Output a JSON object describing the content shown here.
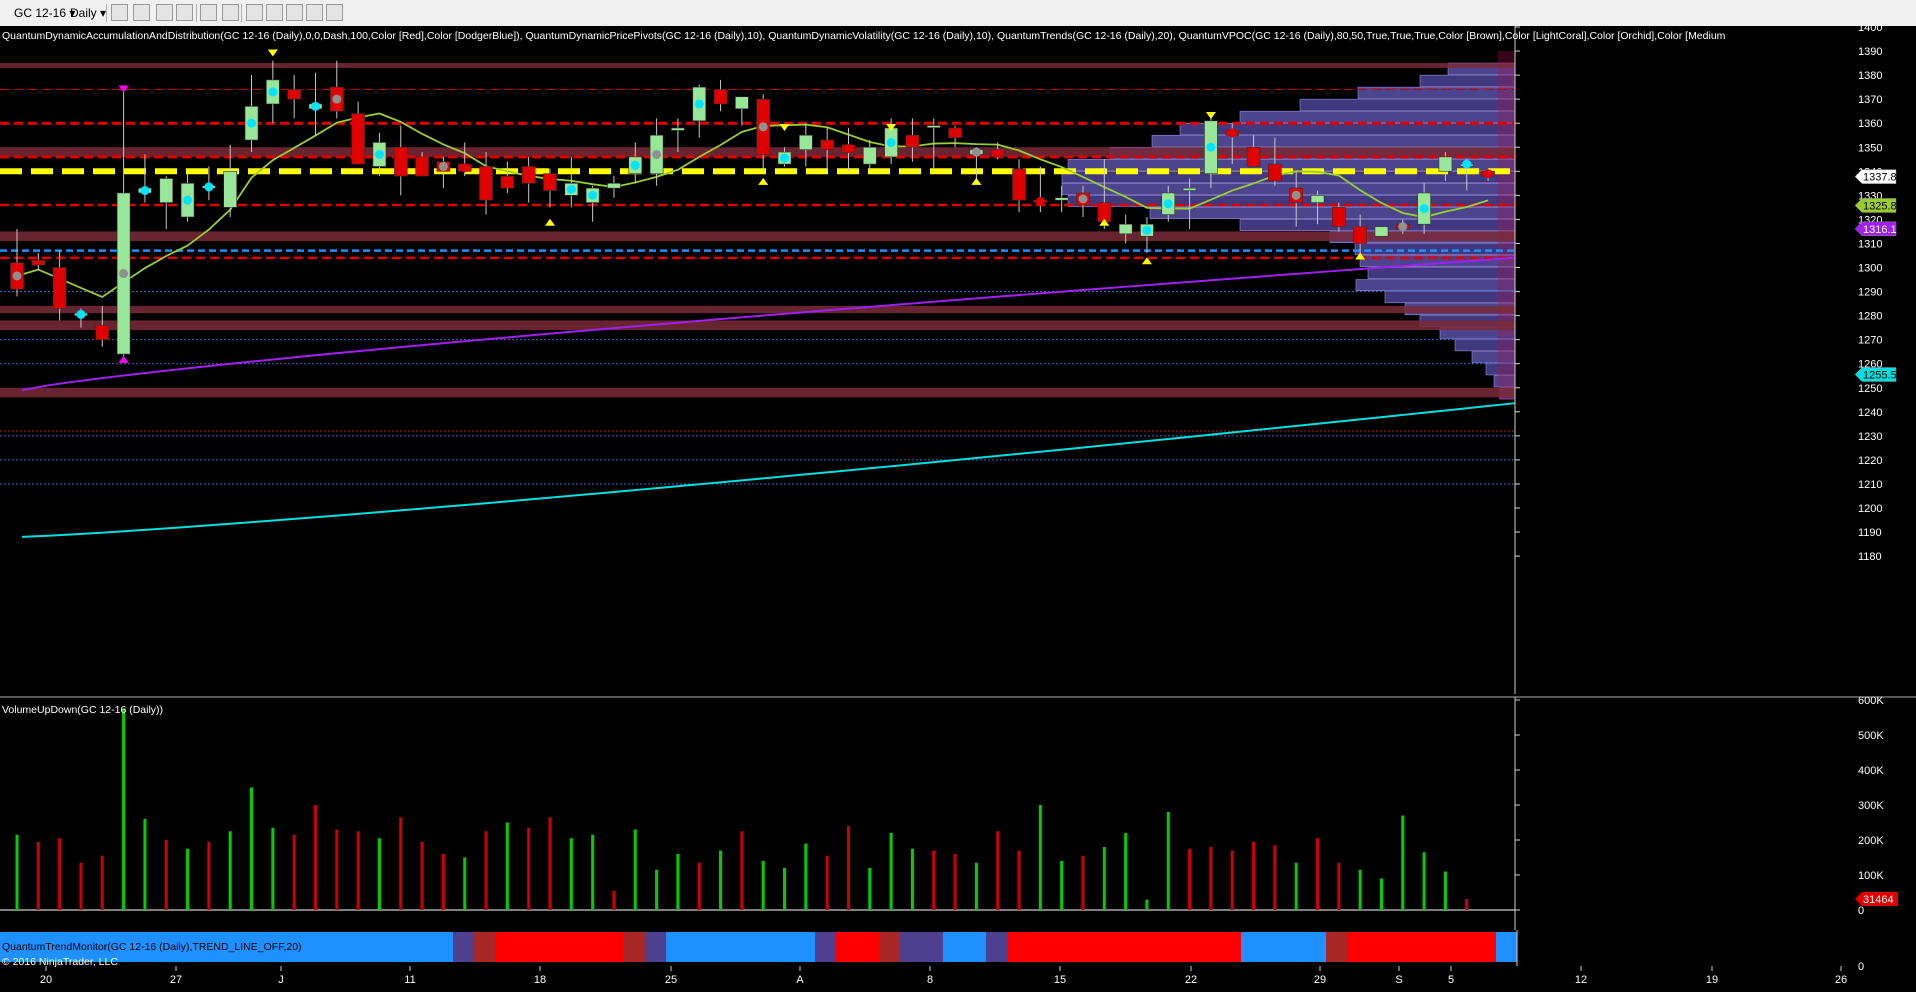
{
  "toolbar": {
    "instrument": "GC 12-16",
    "interval": "Daily"
  },
  "indicators_label": "QuantumDynamicAccumulationAndDistribution(GC 12-16 (Daily),0,0,Dash,100,Color [Red],Color [DodgerBlue]), QuantumDynamicPricePivots(GC 12-16 (Daily),10), QuantumDynamicVolatility(GC 12-16 (Daily),10), QuantumTrends(GC 12-16 (Daily),20), QuantumVPOC(GC 12-16 (Daily),80,50,True,True,True,Color [Brown],Color [LightCoral],Color [Orchid],Color [Medium",
  "volume_label": "VolumeUpDown(GC 12-16 (Daily))",
  "trend_label": "QuantumTrendMonitor(GC 12-16 (Daily),TREND_LINE_OFF,20)",
  "copyright": "© 2016 NinjaTrader, LLC",
  "colors": {
    "up": "#98e698",
    "down": "#e00000",
    "vol_up": "#00d000",
    "vol_down": "#d00000",
    "trend_up": "#1e90ff",
    "trend_down": "#ff0000"
  },
  "chart_data": {
    "type": "candlestick",
    "price_axis": {
      "min": 1180,
      "max": 1400,
      "ticks": [
        1180,
        1190,
        1200,
        1210,
        1220,
        1230,
        1240,
        1250,
        1260,
        1270,
        1280,
        1290,
        1300,
        1310,
        1320,
        1330,
        1340,
        1350,
        1360,
        1370,
        1380,
        1390,
        1400
      ]
    },
    "x_labels": [
      "20",
      "27",
      "J",
      "11",
      "18",
      "25",
      "A",
      "8",
      "15",
      "22",
      "29",
      "S",
      "5",
      "12",
      "19",
      "26"
    ],
    "price_flags": {
      "last": "1337.8",
      "green": "1325.8",
      "purple": "1316.1",
      "cyan": "1255.5"
    },
    "volume_axis": {
      "min": 0,
      "max": 600000,
      "tick_labels": [
        "0",
        "100K",
        "200K",
        "300K",
        "400K",
        "500K",
        "600K"
      ],
      "last": "31464"
    },
    "candles": [
      [
        1302,
        1316,
        1288,
        1291
      ],
      [
        1303,
        1306,
        1299,
        1301
      ],
      [
        1300,
        1307,
        1278,
        1283
      ],
      [
        1280,
        1283,
        1275,
        1281
      ],
      [
        1276,
        1284,
        1267,
        1270
      ],
      [
        1264,
        1373,
        1262,
        1331
      ],
      [
        1331,
        1347,
        1327,
        1333
      ],
      [
        1327,
        1338,
        1316,
        1337
      ],
      [
        1321,
        1339,
        1319,
        1335
      ],
      [
        1333,
        1342,
        1328,
        1334
      ],
      [
        1325,
        1351,
        1321,
        1340
      ],
      [
        1353,
        1380,
        1348,
        1367
      ],
      [
        1368,
        1386,
        1360,
        1378
      ],
      [
        1374,
        1380,
        1362,
        1370
      ],
      [
        1366,
        1381,
        1355,
        1368
      ],
      [
        1375,
        1386,
        1362,
        1365
      ],
      [
        1364,
        1369,
        1344,
        1343
      ],
      [
        1342,
        1356,
        1338,
        1352
      ],
      [
        1350,
        1359,
        1330,
        1338
      ],
      [
        1346,
        1348,
        1338,
        1338
      ],
      [
        1344,
        1346,
        1333,
        1340
      ],
      [
        1343,
        1352,
        1338,
        1340
      ],
      [
        1342,
        1348,
        1322,
        1328
      ],
      [
        1338,
        1344,
        1331,
        1333
      ],
      [
        1342,
        1346,
        1327,
        1335
      ],
      [
        1339,
        1341,
        1325,
        1332
      ],
      [
        1330,
        1346,
        1325,
        1335
      ],
      [
        1327,
        1334,
        1319,
        1333
      ],
      [
        1333,
        1338,
        1329,
        1335
      ],
      [
        1339,
        1352,
        1335,
        1346
      ],
      [
        1339,
        1362,
        1334,
        1355
      ],
      [
        1357,
        1362,
        1348,
        1358
      ],
      [
        1361,
        1376,
        1354,
        1375
      ],
      [
        1374,
        1378,
        1365,
        1368
      ],
      [
        1366,
        1371,
        1359,
        1371
      ],
      [
        1370,
        1372,
        1340,
        1347
      ],
      [
        1343,
        1350,
        1342,
        1348
      ],
      [
        1349,
        1360,
        1342,
        1355
      ],
      [
        1353,
        1358,
        1340,
        1349
      ],
      [
        1351,
        1358,
        1340,
        1348
      ],
      [
        1343,
        1353,
        1340,
        1350
      ],
      [
        1346,
        1362,
        1343,
        1358
      ],
      [
        1355,
        1362,
        1344,
        1350
      ],
      [
        1359,
        1362,
        1341,
        1359
      ],
      [
        1358,
        1359,
        1350,
        1354
      ],
      [
        1347,
        1350,
        1336,
        1349
      ],
      [
        1349,
        1352,
        1345,
        1346
      ],
      [
        1341,
        1345,
        1323,
        1328
      ],
      [
        1328,
        1342,
        1323,
        1327
      ],
      [
        1328,
        1334,
        1323,
        1329
      ],
      [
        1331,
        1334,
        1321,
        1326
      ],
      [
        1327,
        1345,
        1316,
        1319
      ],
      [
        1314,
        1322,
        1310,
        1318
      ],
      [
        1313,
        1321,
        1306,
        1318
      ],
      [
        1322,
        1334,
        1319,
        1331
      ],
      [
        1332,
        1337,
        1316,
        1333
      ],
      [
        1339,
        1364,
        1333,
        1361
      ],
      [
        1357,
        1360,
        1343,
        1355
      ],
      [
        1350,
        1355,
        1343,
        1342
      ],
      [
        1343,
        1354,
        1334,
        1336
      ],
      [
        1333,
        1340,
        1317,
        1327
      ],
      [
        1327,
        1332,
        1318,
        1330
      ],
      [
        1325,
        1327,
        1315,
        1317
      ],
      [
        1317,
        1322,
        1306,
        1310
      ],
      [
        1313,
        1317,
        1313,
        1317
      ],
      [
        1318,
        1320,
        1314,
        1316
      ],
      [
        1318,
        1335,
        1314,
        1331
      ],
      [
        1340,
        1348,
        1336,
        1346
      ],
      [
        1343,
        1345,
        1332,
        1343
      ],
      [
        1340,
        1341,
        1336,
        1338
      ]
    ],
    "volume": [
      [
        215000,
        1
      ],
      [
        195000,
        0
      ],
      [
        205000,
        0
      ],
      [
        135000,
        0
      ],
      [
        155000,
        0
      ],
      [
        575000,
        1
      ],
      [
        260000,
        1
      ],
      [
        200000,
        0
      ],
      [
        175000,
        1
      ],
      [
        195000,
        0
      ],
      [
        225000,
        1
      ],
      [
        350000,
        1
      ],
      [
        235000,
        1
      ],
      [
        215000,
        0
      ],
      [
        300000,
        0
      ],
      [
        230000,
        0
      ],
      [
        225000,
        0
      ],
      [
        205000,
        1
      ],
      [
        265000,
        0
      ],
      [
        195000,
        0
      ],
      [
        160000,
        0
      ],
      [
        150000,
        1
      ],
      [
        225000,
        0
      ],
      [
        250000,
        1
      ],
      [
        235000,
        0
      ],
      [
        265000,
        0
      ],
      [
        205000,
        1
      ],
      [
        215000,
        1
      ],
      [
        55000,
        0
      ],
      [
        230000,
        1
      ],
      [
        115000,
        1
      ],
      [
        160000,
        1
      ],
      [
        135000,
        0
      ],
      [
        170000,
        1
      ],
      [
        225000,
        0
      ],
      [
        140000,
        1
      ],
      [
        120000,
        1
      ],
      [
        190000,
        1
      ],
      [
        155000,
        0
      ],
      [
        240000,
        0
      ],
      [
        120000,
        1
      ],
      [
        220000,
        1
      ],
      [
        175000,
        1
      ],
      [
        170000,
        0
      ],
      [
        160000,
        0
      ],
      [
        135000,
        1
      ],
      [
        225000,
        0
      ],
      [
        170000,
        0
      ],
      [
        300000,
        1
      ],
      [
        140000,
        1
      ],
      [
        155000,
        0
      ],
      [
        180000,
        1
      ],
      [
        220000,
        1
      ],
      [
        30000,
        1
      ],
      [
        280000,
        1
      ],
      [
        175000,
        0
      ],
      [
        180000,
        0
      ],
      [
        170000,
        0
      ],
      [
        195000,
        0
      ],
      [
        185000,
        0
      ],
      [
        135000,
        1
      ],
      [
        205000,
        0
      ],
      [
        135000,
        0
      ],
      [
        115000,
        1
      ],
      [
        90000,
        1
      ],
      [
        270000,
        1
      ],
      [
        165000,
        1
      ],
      [
        110000,
        1
      ],
      [
        31464,
        0
      ]
    ],
    "trend_monitor": [
      [
        0,
        453,
        "#1e90ff"
      ],
      [
        453,
        474,
        "#4e3f8f"
      ],
      [
        474,
        495,
        "#a82828"
      ],
      [
        495,
        623,
        "#ff0000"
      ],
      [
        623,
        645,
        "#a82828"
      ],
      [
        645,
        666,
        "#4e3f8f"
      ],
      [
        666,
        815,
        "#1e90ff"
      ],
      [
        815,
        836,
        "#4e3f8f"
      ],
      [
        836,
        880,
        "#ff0000"
      ],
      [
        880,
        900,
        "#a82828"
      ],
      [
        900,
        943,
        "#4e3f8f"
      ],
      [
        943,
        986,
        "#1e90ff"
      ],
      [
        986,
        1007,
        "#4e3f8f"
      ],
      [
        1007,
        1241,
        "#ff0000"
      ],
      [
        1241,
        1326,
        "#1e90ff"
      ],
      [
        1326,
        1347,
        "#a82828"
      ],
      [
        1347,
        1496,
        "#ff0000"
      ],
      [
        1496,
        1517,
        "#1e90ff"
      ]
    ]
  }
}
